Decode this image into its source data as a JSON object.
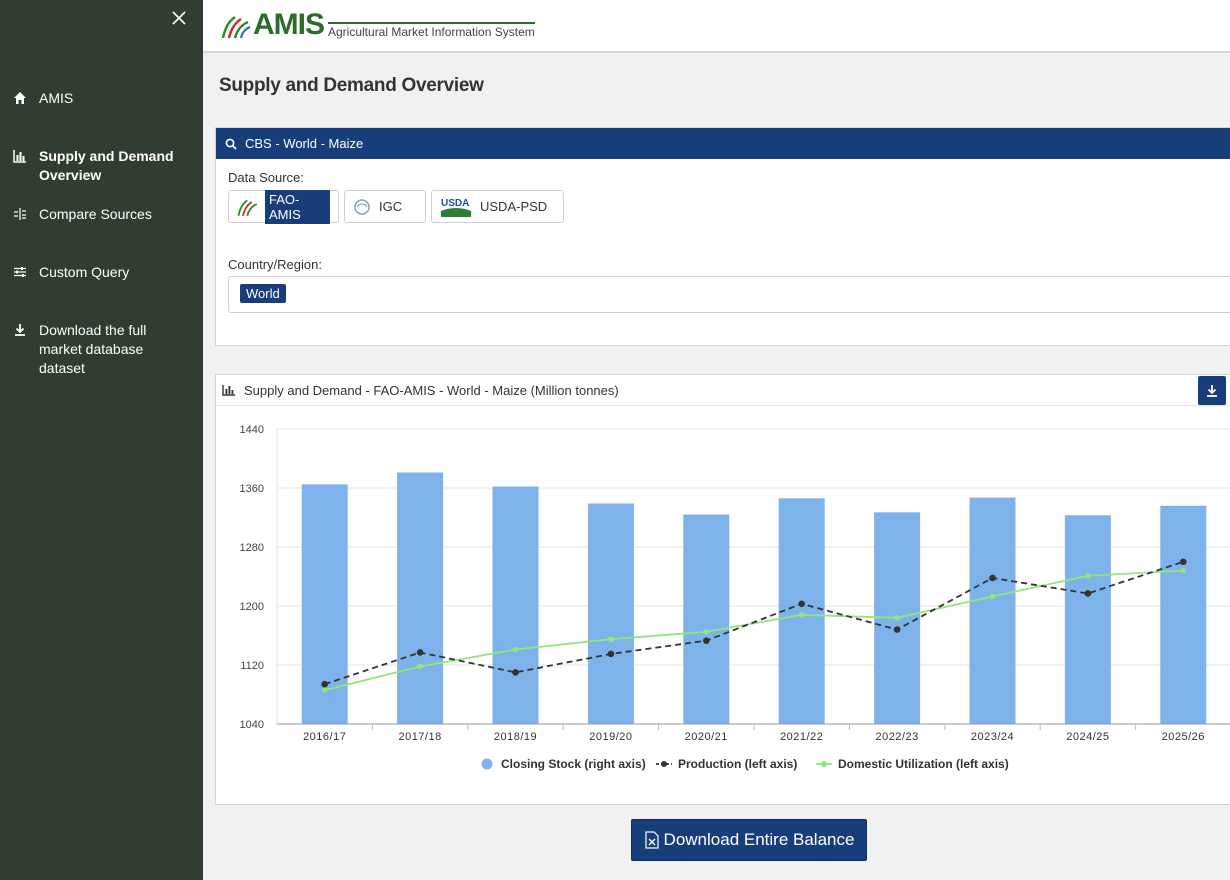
{
  "sidebar": {
    "items": [
      {
        "label": "AMIS",
        "icon": "home-icon"
      },
      {
        "label": "Supply and Demand Overview",
        "icon": "bar-chart-icon",
        "active": true
      },
      {
        "label": "Compare Sources",
        "icon": "compare-icon"
      },
      {
        "label": "Custom Query",
        "icon": "sliders-icon"
      },
      {
        "label": "Download the full market database dataset",
        "icon": "download-icon"
      }
    ]
  },
  "header": {
    "logo_text": "AMIS",
    "logo_subtitle": "Agricultural Market Information System"
  },
  "page_title": "Supply and Demand Overview",
  "filter_panel": {
    "title": "CBS - World - Maize",
    "data_source_label": "Data Source:",
    "sources": [
      {
        "label": "FAO-AMIS",
        "selected": true
      },
      {
        "label": "IGC",
        "selected": false
      },
      {
        "label": "USDA-PSD",
        "selected": false
      }
    ],
    "country_label": "Country/Region:",
    "country_value": "World"
  },
  "chart_panel": {
    "title": "Supply and Demand - FAO-AMIS - World - Maize (Million tonnes)"
  },
  "download_button": "Download Entire Balance",
  "colors": {
    "sidebar_bg": "#323d31",
    "navy": "#173e7a",
    "bar": "#7db3ea",
    "production": "#333333",
    "utilization": "#90e87a"
  },
  "chart_data": {
    "type": "bar",
    "categories": [
      "2016/17",
      "2017/18",
      "2018/19",
      "2019/20",
      "2020/21",
      "2021/22",
      "2022/23",
      "2023/24",
      "2024/25",
      "2025/26"
    ],
    "y_ticks": [
      1040,
      1120,
      1200,
      1280,
      1360,
      1440
    ],
    "ylim": [
      1040,
      1440
    ],
    "grid": true,
    "legend_position": "bottom",
    "series": [
      {
        "name": "Closing Stock (right axis)",
        "type": "bar",
        "values": [
          1365,
          1381,
          1362,
          1339,
          1324,
          1346,
          1327,
          1347,
          1323,
          1336
        ]
      },
      {
        "name": "Production (left axis)",
        "type": "line",
        "dashed": true,
        "values": [
          1094,
          1137,
          1110,
          1135,
          1153,
          1203,
          1168,
          1238,
          1217,
          1260
        ]
      },
      {
        "name": "Domestic Utilization (left axis)",
        "type": "line",
        "values": [
          1086,
          1118,
          1141,
          1155,
          1165,
          1188,
          1184,
          1213,
          1241,
          1248
        ]
      }
    ]
  }
}
